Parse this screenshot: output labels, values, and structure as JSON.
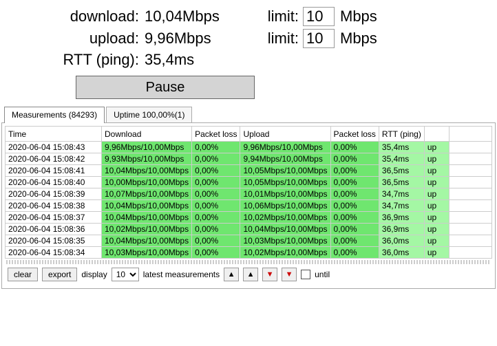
{
  "stats": {
    "download_label": "download:",
    "download_value": "10,04Mbps",
    "upload_label": "upload:",
    "upload_value": "9,96Mbps",
    "rtt_label": "RTT (ping):",
    "rtt_value": "35,4ms",
    "limit_label": "limit:",
    "limit_download": "10",
    "limit_upload": "10",
    "limit_unit": "Mbps"
  },
  "pause_label": "Pause",
  "tabs": {
    "measurements": "Measurements  (84293)",
    "uptime": "Uptime  100,00%(1)"
  },
  "headers": {
    "time": "Time",
    "download": "Download",
    "pl1": "Packet loss",
    "upload": "Upload",
    "pl2": "Packet loss",
    "rtt": "RTT (ping)"
  },
  "rows": [
    {
      "time": "2020-06-04 15:08:43",
      "dl": "9,96Mbps/10,00Mbps",
      "pl1": "0,00%",
      "ul": "9,96Mbps/10,00Mbps",
      "pl2": "0,00%",
      "rtt": "35,4ms",
      "up": "up"
    },
    {
      "time": "2020-06-04 15:08:42",
      "dl": "9,93Mbps/10,00Mbps",
      "pl1": "0,00%",
      "ul": "9,94Mbps/10,00Mbps",
      "pl2": "0,00%",
      "rtt": "35,4ms",
      "up": "up"
    },
    {
      "time": "2020-06-04 15:08:41",
      "dl": "10,04Mbps/10,00Mbps",
      "pl1": "0,00%",
      "ul": "10,05Mbps/10,00Mbps",
      "pl2": "0,00%",
      "rtt": "36,5ms",
      "up": "up"
    },
    {
      "time": "2020-06-04 15:08:40",
      "dl": "10,00Mbps/10,00Mbps",
      "pl1": "0,00%",
      "ul": "10,05Mbps/10,00Mbps",
      "pl2": "0,00%",
      "rtt": "36,5ms",
      "up": "up"
    },
    {
      "time": "2020-06-04 15:08:39",
      "dl": "10,07Mbps/10,00Mbps",
      "pl1": "0,00%",
      "ul": "10,01Mbps/10,00Mbps",
      "pl2": "0,00%",
      "rtt": "34,7ms",
      "up": "up"
    },
    {
      "time": "2020-06-04 15:08:38",
      "dl": "10,04Mbps/10,00Mbps",
      "pl1": "0,00%",
      "ul": "10,06Mbps/10,00Mbps",
      "pl2": "0,00%",
      "rtt": "34,7ms",
      "up": "up"
    },
    {
      "time": "2020-06-04 15:08:37",
      "dl": "10,04Mbps/10,00Mbps",
      "pl1": "0,00%",
      "ul": "10,02Mbps/10,00Mbps",
      "pl2": "0,00%",
      "rtt": "36,9ms",
      "up": "up"
    },
    {
      "time": "2020-06-04 15:08:36",
      "dl": "10,02Mbps/10,00Mbps",
      "pl1": "0,00%",
      "ul": "10,04Mbps/10,00Mbps",
      "pl2": "0,00%",
      "rtt": "36,9ms",
      "up": "up"
    },
    {
      "time": "2020-06-04 15:08:35",
      "dl": "10,04Mbps/10,00Mbps",
      "pl1": "0,00%",
      "ul": "10,03Mbps/10,00Mbps",
      "pl2": "0,00%",
      "rtt": "36,0ms",
      "up": "up"
    },
    {
      "time": "2020-06-04 15:08:34",
      "dl": "10,03Mbps/10,00Mbps",
      "pl1": "0,00%",
      "ul": "10,02Mbps/10,00Mbps",
      "pl2": "0,00%",
      "rtt": "36,0ms",
      "up": "up"
    }
  ],
  "toolbar": {
    "clear": "clear",
    "export": "export",
    "display": "display",
    "count": "10",
    "latest": "latest measurements",
    "until": "until"
  }
}
